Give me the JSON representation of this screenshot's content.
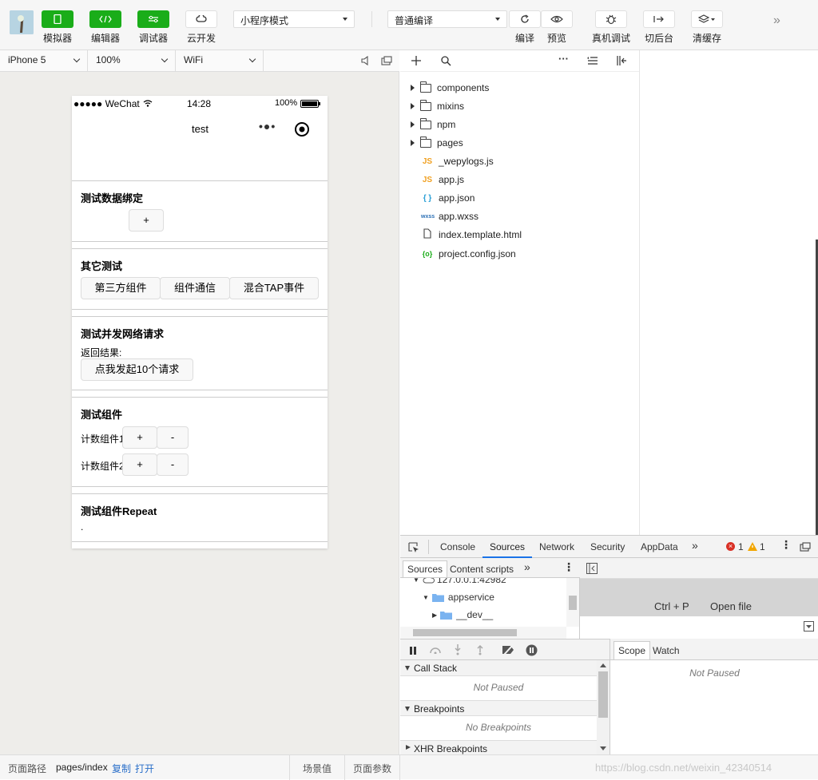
{
  "toolbar": {
    "simulator": "模拟器",
    "editor": "编辑器",
    "debugger": "调试器",
    "cloud": "云开发",
    "mode": "小程序模式",
    "compile_mode": "普通编译",
    "compile": "编译",
    "preview": "预览",
    "real_debug": "真机调试",
    "background": "切后台",
    "clear_cache": "清缓存"
  },
  "simbar": {
    "device": "iPhone 5",
    "zoom": "100%",
    "network": "WiFi"
  },
  "phone": {
    "signal": "●●●●● WeChat",
    "time": "14:28",
    "battery": "100%",
    "title": "test",
    "sections": {
      "binding": {
        "title": "测试数据绑定",
        "btn": "+"
      },
      "other": {
        "title": "其它测试",
        "btn1": "第三方组件",
        "btn2": "组件通信",
        "btn3": "混合TAP事件"
      },
      "network": {
        "title": "测试并发网络请求",
        "label": "返回结果:",
        "btn": "点我发起10个请求"
      },
      "component": {
        "title": "测试组件",
        "c1": "计数组件1",
        "c2": "计数组件2",
        "plus": "+",
        "minus": "-"
      },
      "repeat": {
        "title": "测试组件Repeat",
        "dot": "."
      }
    }
  },
  "files": {
    "folders": [
      "components",
      "mixins",
      "npm",
      "pages"
    ],
    "items": [
      {
        "icon": "JS",
        "name": "_wepylogs.js",
        "color": "#f0a020"
      },
      {
        "icon": "JS",
        "name": "app.js",
        "color": "#f0a020"
      },
      {
        "icon": "{ }",
        "name": "app.json",
        "color": "#2a9fd6"
      },
      {
        "icon": "wxss",
        "name": "app.wxss",
        "color": "#2a6fb5"
      },
      {
        "icon": "",
        "name": "index.template.html",
        "color": "#444"
      },
      {
        "icon": "{o}",
        "name": "project.config.json",
        "color": "#1aad19"
      }
    ]
  },
  "devtools": {
    "tabs": [
      "Console",
      "Sources",
      "Network",
      "Security",
      "AppData"
    ],
    "errors": "1",
    "warnings": "1",
    "subtabs": [
      "Sources",
      "Content scripts"
    ],
    "tree": [
      "127.0.0.1:42982",
      "appservice",
      "__dev__"
    ],
    "shortcut": "Ctrl + P",
    "open_file": "Open file",
    "call_stack": "Call Stack",
    "not_paused": "Not Paused",
    "breakpoints": "Breakpoints",
    "no_breakpoints": "No Breakpoints",
    "xhr": "XHR Breakpoints",
    "scope": "Scope",
    "watch": "Watch",
    "scope_not_paused": "Not Paused"
  },
  "footer": {
    "path_label": "页面路径",
    "path": "pages/index",
    "copy": "复制",
    "open": "打开",
    "scene": "场景值",
    "params": "页面参数",
    "watermark": "https://blog.csdn.net/weixin_42340514"
  }
}
